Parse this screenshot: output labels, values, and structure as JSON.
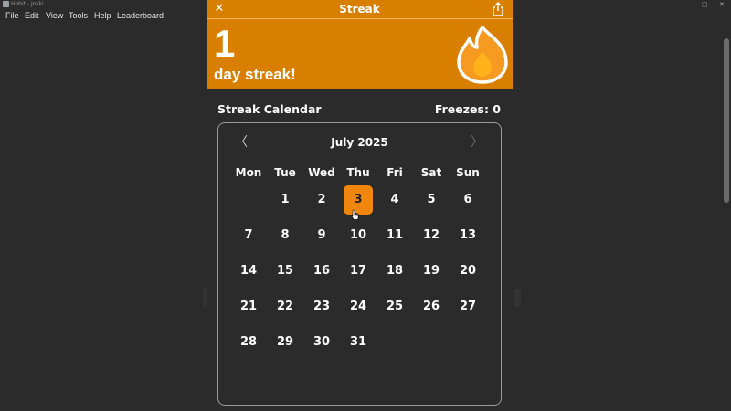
{
  "window": {
    "title": "Hobit - Joski",
    "controls": [
      "—",
      "▢",
      "✕"
    ]
  },
  "menu": [
    "File",
    "Edit",
    "View",
    "Tools",
    "Help",
    "Leaderboard"
  ],
  "header": {
    "title": "Streak",
    "close_icon": "close-icon",
    "share_icon": "share-icon"
  },
  "hero": {
    "streak_count": "1",
    "streak_label": "day streak!",
    "icon": "flame-icon",
    "accent_color": "#d97f00"
  },
  "calendar": {
    "section_title": "Streak Calendar",
    "freezes_label": "Freezes: 0",
    "month_label": "July 2025",
    "prev_icon": "chevron-left-icon",
    "next_icon": "chevron-right-icon",
    "weekdays": [
      "Mon",
      "Tue",
      "Wed",
      "Thu",
      "Fri",
      "Sat",
      "Sun"
    ],
    "days": [
      "1",
      "2",
      "3",
      "4",
      "5",
      "6",
      "7",
      "8",
      "9",
      "10",
      "11",
      "12",
      "13",
      "14",
      "15",
      "16",
      "17",
      "18",
      "19",
      "20",
      "21",
      "22",
      "23",
      "24",
      "25",
      "26",
      "27",
      "28",
      "29",
      "30",
      "31"
    ],
    "highlighted_day": "3",
    "highlight_color": "#f0860b"
  }
}
